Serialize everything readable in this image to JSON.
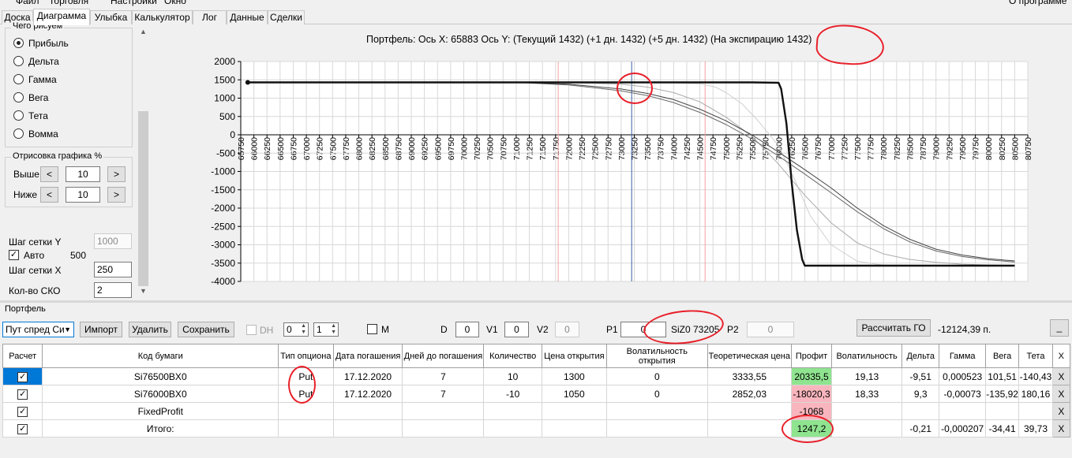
{
  "menubar": {
    "items": [
      "Файл",
      "Торговля",
      "Настройки",
      "Окно"
    ],
    "right_item": "О программе"
  },
  "tabs": [
    "Доска",
    "Диаграмма",
    "Улыбка",
    "Калькулятор",
    "Лог",
    "Данные",
    "Сделки"
  ],
  "active_tab": "Диаграмма",
  "left_panel": {
    "draw_group_title": "Чего рисуем",
    "radios": [
      {
        "label": "Прибыль",
        "selected": true
      },
      {
        "label": "Дельта",
        "selected": false
      },
      {
        "label": "Гамма",
        "selected": false
      },
      {
        "label": "Вега",
        "selected": false
      },
      {
        "label": "Тета",
        "selected": false
      },
      {
        "label": "Вомма",
        "selected": false
      }
    ],
    "render_group_title": "Отрисовка графика %",
    "above_label": "Выше",
    "above_value": "10",
    "below_label": "Ниже",
    "below_value": "10",
    "dec_glyph": "<",
    "inc_glyph": ">",
    "grid_y_label": "Шаг сетки Y",
    "grid_y_value": "1000",
    "auto_label": "Авто",
    "auto_checked": true,
    "auto_value": "500",
    "grid_x_label": "Шаг сетки X",
    "grid_x_value": "250",
    "sko_label": "Кол-во СКО",
    "sko_value": "2"
  },
  "chart_data": {
    "type": "line",
    "title": "Портфель: Ось X: 65883 Ось Y:  (Текущий 1432)  (+1 дн. 1432)  (+5 дн. 1432)  (На экспирацию 1432)",
    "xlabel": "",
    "ylabel": "",
    "xlim": [
      65750,
      80750
    ],
    "ylim": [
      -4000,
      2000
    ],
    "x_ticks": [
      65750,
      66000,
      66250,
      66500,
      66750,
      67000,
      67250,
      67500,
      67750,
      68000,
      68250,
      68500,
      68750,
      69000,
      69250,
      69500,
      69750,
      70000,
      70250,
      70500,
      70750,
      71000,
      71250,
      71500,
      71750,
      72000,
      72250,
      72500,
      72750,
      73000,
      73250,
      73500,
      73750,
      74000,
      74250,
      74500,
      74750,
      75000,
      75250,
      75500,
      75750,
      76000,
      76250,
      76500,
      76750,
      77000,
      77250,
      77500,
      77750,
      78000,
      78250,
      78500,
      78750,
      79000,
      79250,
      79500,
      79750,
      80000,
      80250,
      80500,
      80750
    ],
    "y_ticks": [
      2000,
      1500,
      1000,
      500,
      0,
      -500,
      -1000,
      -1500,
      -2000,
      -2500,
      -3000,
      -3500,
      -4000
    ],
    "grid": true,
    "vertical_markers": [
      {
        "x": 71800,
        "color": "#f4a0a0"
      },
      {
        "x": 73200,
        "color": "#3a5fa8"
      },
      {
        "x": 74600,
        "color": "#f4a0a0"
      }
    ],
    "series": [
      {
        "color": "#111111",
        "width": 2.4,
        "x": [
          65883,
          72000,
          74000,
          75500,
          76000,
          76050,
          76150,
          76250,
          76350,
          76450,
          76500,
          80500
        ],
        "y": [
          1430,
          1430,
          1430,
          1430,
          1420,
          1250,
          300,
          -1300,
          -2600,
          -3400,
          -3570,
          -3570
        ]
      },
      {
        "color": "#444444",
        "width": 1,
        "x": [
          65883,
          71000,
          72000,
          73000,
          73500,
          74000,
          74500,
          75000,
          75500,
          76000,
          76500,
          77000,
          77500,
          78000,
          78500,
          79000,
          79500,
          80000,
          80500
        ],
        "y": [
          1430,
          1430,
          1380,
          1250,
          1130,
          960,
          700,
          380,
          -10,
          -470,
          -950,
          -1450,
          -2000,
          -2480,
          -2850,
          -3120,
          -3280,
          -3380,
          -3440
        ]
      },
      {
        "color": "#666666",
        "width": 1,
        "x": [
          65883,
          71000,
          72000,
          73000,
          73500,
          74000,
          74500,
          75000,
          75500,
          76000,
          76500,
          77000,
          77500,
          78000,
          78500,
          79000,
          79500,
          80000,
          80500
        ],
        "y": [
          1430,
          1430,
          1360,
          1200,
          1070,
          880,
          610,
          280,
          -120,
          -580,
          -1070,
          -1580,
          -2100,
          -2560,
          -2920,
          -3170,
          -3320,
          -3410,
          -3470
        ]
      },
      {
        "color": "#aaaaaa",
        "width": 1,
        "x": [
          65883,
          72000,
          73000,
          73500,
          74000,
          74500,
          75000,
          75500,
          76000,
          76500,
          77000,
          77500,
          78000,
          78500,
          79000,
          79500,
          80000,
          80500
        ],
        "y": [
          1430,
          1425,
          1380,
          1300,
          1150,
          900,
          480,
          -50,
          -800,
          -1650,
          -2400,
          -2950,
          -3250,
          -3400,
          -3480,
          -3530,
          -3550,
          -3560
        ]
      },
      {
        "color": "#d0d0d0",
        "width": 1,
        "x": [
          65883,
          73500,
          74000,
          74500,
          74800,
          75000,
          75300,
          75600,
          76000,
          76300,
          76600,
          77000,
          77500,
          78000,
          80500
        ],
        "y": [
          1430,
          1430,
          1420,
          1390,
          1300,
          1150,
          850,
          400,
          -300,
          -1200,
          -2200,
          -3000,
          -3450,
          -3560,
          -3570
        ]
      }
    ]
  },
  "portfolio": {
    "group_title": "Портфель",
    "select_value": "Пут спред Си",
    "import_label": "Импорт",
    "delete_label": "Удалить",
    "save_label": "Сохранить",
    "dh_label": "DH",
    "spin1_value": "0",
    "spin2_value": "1",
    "m_label": "M",
    "d_label": "D",
    "d_value": "0",
    "v1_label": "V1",
    "v1_value": "0",
    "v2_label": "V2",
    "v2_value": "0",
    "p1_label": "P1",
    "p1_value": "0",
    "p1_symbol": "SiZ0 73205",
    "p2_label": "P2",
    "p2_value": "0",
    "calc_go_label": "Рассчитать ГО",
    "go_value": "-12124,39 п.",
    "minimize_label": "_"
  },
  "table": {
    "headers": [
      "Расчет",
      "Код бумаги",
      "Тип опциона",
      "Дата погашения",
      "Дней до погашения",
      "Количество",
      "Цена открытия",
      "Волатильность открытия",
      "Теоретическая цена",
      "Профит",
      "Волатильность",
      "Дельта",
      "Гамма",
      "Вега",
      "Тета",
      "X"
    ],
    "rows": [
      {
        "checked": "✓",
        "code": "Si76500BX0",
        "type": "Put",
        "date": "17.12.2020",
        "days": "7",
        "qty": "10",
        "open_price": "1300",
        "open_vol": "0",
        "theo": "3333,55",
        "profit": "20335,5",
        "profit_color": "g",
        "vol": "19,13",
        "delta": "-9,51",
        "gamma": "0,000523",
        "vega": "101,51",
        "theta": "-140,43",
        "x": "X"
      },
      {
        "checked": "✓",
        "code": "Si76000BX0",
        "type": "Put",
        "date": "17.12.2020",
        "days": "7",
        "qty": "-10",
        "open_price": "1050",
        "open_vol": "0",
        "theo": "2852,03",
        "profit": "-18020,3",
        "profit_color": "r",
        "vol": "18,33",
        "delta": "9,3",
        "gamma": "-0,00073",
        "vega": "-135,92",
        "theta": "180,16",
        "x": "X"
      },
      {
        "checked": "✓",
        "code": "FixedProfit",
        "type": "",
        "date": "",
        "days": "",
        "qty": "",
        "open_price": "",
        "open_vol": "",
        "theo": "",
        "profit": "-1068",
        "profit_color": "r",
        "vol": "",
        "delta": "",
        "gamma": "",
        "vega": "",
        "theta": "",
        "x": "X"
      },
      {
        "checked": "✓",
        "code": "Итого:",
        "type": "",
        "date": "",
        "days": "",
        "qty": "",
        "open_price": "",
        "open_vol": "",
        "theo": "",
        "profit": "1247,2",
        "profit_color": "g",
        "vol": "",
        "delta": "-0,21",
        "gamma": "-0,000207",
        "vega": "-34,41",
        "theta": "39,73",
        "x": "X"
      }
    ]
  },
  "colors": {
    "profit_positive": "#8fe48f",
    "profit_negative": "#f9b5bd",
    "annotation": "#e8202a",
    "selected_row": "#0078d7"
  }
}
